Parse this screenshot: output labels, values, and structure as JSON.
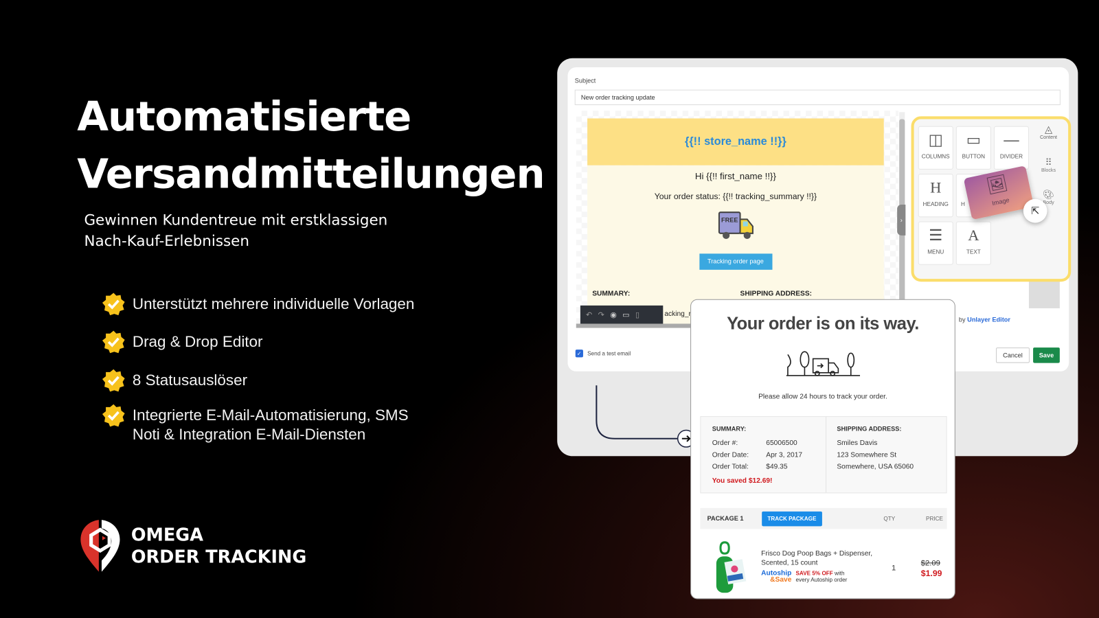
{
  "hero": {
    "title_line1": "Automatisierte",
    "title_line2": "Versandmitteilungen",
    "subtitle_line1": "Gewinnen Kundentreue mit erstklassigen",
    "subtitle_line2": "Nach-Kauf-Erlebnissen"
  },
  "features": [
    {
      "text": "Unterstützt mehrere individuelle Vorlagen"
    },
    {
      "text": "Drag & Drop Editor"
    },
    {
      "text": "8 Statusauslöser"
    },
    {
      "text": "Integrierte E-Mail-Automatisierung, SMS",
      "text2": "Noti & Integration E-Mail-Diensten"
    }
  ],
  "brand": {
    "line1": "OMEGA",
    "line2": "ORDER TRACKING",
    "red": "#d9332b"
  },
  "editor": {
    "subject_label": "Subject",
    "subject_value": "New order tracking update",
    "store_name": "{{!! store_name !!}}",
    "greeting": "Hi {{!! first_name !!}}",
    "status": "Your order status: {{!! tracking_summary !!}}",
    "truck_label": "FREE",
    "tracking_button": "Tracking order page",
    "summary": "SUMMARY:",
    "shipping": "SHIPPING ADDRESS:",
    "tracking_partial": "acking_r",
    "tools": [
      "COLUMNS",
      "BUTTON",
      "DIVIDER",
      "HEADING",
      "H",
      "MENU",
      "TEXT"
    ],
    "drag_tile": "Image",
    "side_tabs": [
      "Content",
      "Blocks",
      "Body"
    ],
    "powered": "by",
    "powered_link": "Unlayer Editor",
    "test_email": "Send a test email",
    "test_email_checked": true,
    "cancel": "Cancel",
    "save": "Save",
    "accent": "#1a8a4a"
  },
  "preview": {
    "heading": "Your order is on its way.",
    "note": "Please allow 24 hours to track your order.",
    "summary_title": "SUMMARY:",
    "summary": [
      {
        "k": "Order #:",
        "v": "65006500"
      },
      {
        "k": "Order Date:",
        "v": "Apr 3, 2017"
      },
      {
        "k": "Order Total:",
        "v": "$49.35"
      }
    ],
    "saved": "You saved $12.69!",
    "ship_title": "SHIPPING ADDRESS:",
    "ship": [
      "Smiles Davis",
      "123 Somewhere St",
      "Somewhere, USA 65060"
    ],
    "package": "PACKAGE 1",
    "track": "TRACK PACKAGE",
    "qty_h": "QTY",
    "price_h": "PRICE",
    "item": {
      "name1": "Frisco Dog Poop Bags + Dispenser,",
      "name2": "Scented, 15 count",
      "autoship1": "Autoship",
      "autoship2": "&Save",
      "promo_red": "SAVE 5% OFF",
      "promo1": " with",
      "promo2": "every Autoship order",
      "qty": "1",
      "old_price": "$2.09",
      "price": "$1.99"
    }
  }
}
